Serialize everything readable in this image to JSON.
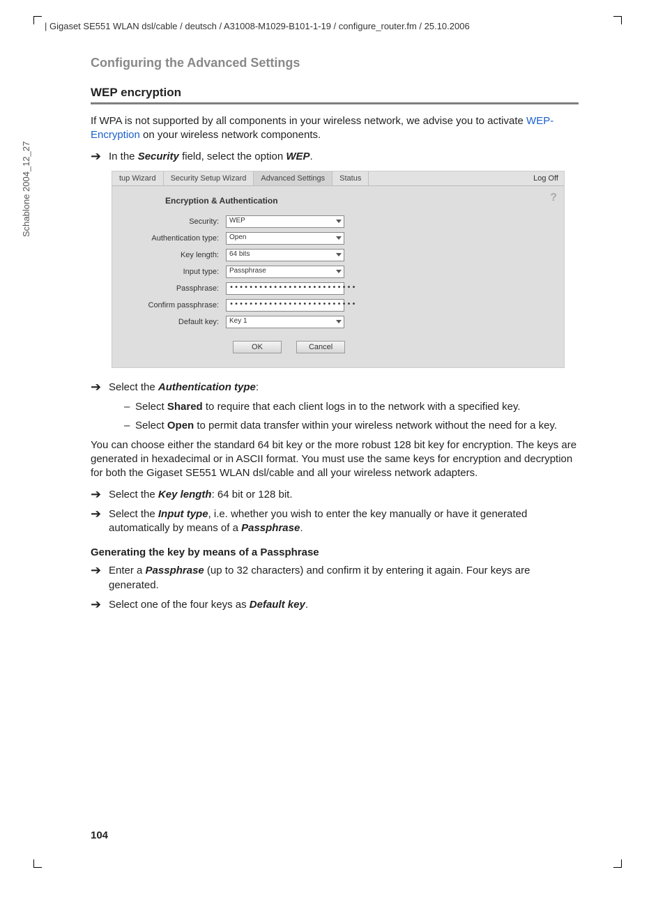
{
  "header": "| Gigaset SE551 WLAN dsl/cable / deutsch / A31008-M1029-B101-1-19 / configure_router.fm / 25.10.2006",
  "side": "Schablone 2004_12_27",
  "chapter": "Configuring the Advanced Settings",
  "section": "WEP encryption",
  "intro_a": "If WPA is not supported by all components in your wireless network, we advise you to activate ",
  "intro_link": "WEP",
  "intro_b": "-Encryption",
  "intro_c": " on your wireless network components.",
  "step1_a": "In the ",
  "step1_b": "Security",
  "step1_c": " field, select the option ",
  "step1_d": "WEP",
  "step1_e": ".",
  "screenshot": {
    "tabs": [
      "tup Wizard",
      "Security Setup Wizard",
      "Advanced Settings",
      "Status"
    ],
    "logoff": "Log Off",
    "heading": "Encryption & Authentication",
    "rows": {
      "security": {
        "label": "Security:",
        "value": "WEP"
      },
      "auth": {
        "label": "Authentication type:",
        "value": "Open"
      },
      "keylen": {
        "label": "Key length:",
        "value": "64 bits"
      },
      "inputtype": {
        "label": "Input type:",
        "value": "Passphrase"
      },
      "pass": {
        "label": "Passphrase:",
        "value": "••••••••••••••••••••••••••"
      },
      "confirm": {
        "label": "Confirm passphrase:",
        "value": "••••••••••••••••••••••••••"
      },
      "defkey": {
        "label": "Default key:",
        "value": "Key 1"
      }
    },
    "ok": "OK",
    "cancel": "Cancel"
  },
  "step2_a": "Select the ",
  "step2_b": "Authentication type",
  "step2_c": ":",
  "sub1_a": "Select ",
  "sub1_b": "Shared",
  "sub1_c": " to require that each client logs in to the network with a specified key.",
  "sub2_a": "Select ",
  "sub2_b": "Open",
  "sub2_c": " to permit data transfer within your wireless network without the need for a key.",
  "para2": "You can choose either the standard 64 bit key or the more robust 128 bit key for encryption. The keys are generated in hexadecimal or in ASCII format. You must use the same keys for encryption and decryption for both the Gigaset SE551 WLAN dsl/cable and all your wireless network adapters.",
  "step3_a": "Select the ",
  "step3_b": "Key length",
  "step3_c": ": 64 bit or 128 bit.",
  "step4_a": "Select the ",
  "step4_b": "Input type",
  "step4_c": ", i.e. whether you wish to enter the key manually or have it generated automatically by means of a ",
  "step4_d": "Passphrase",
  "step4_e": ".",
  "gen_heading": "Generating the key by means of a Passphrase",
  "step5_a": "Enter a ",
  "step5_b": "Passphrase",
  "step5_c": " (up to 32 characters) and confirm it by entering it again. Four keys are generated.",
  "step6_a": "Select one of the four keys as ",
  "step6_b": "Default key",
  "step6_c": ".",
  "page": "104"
}
